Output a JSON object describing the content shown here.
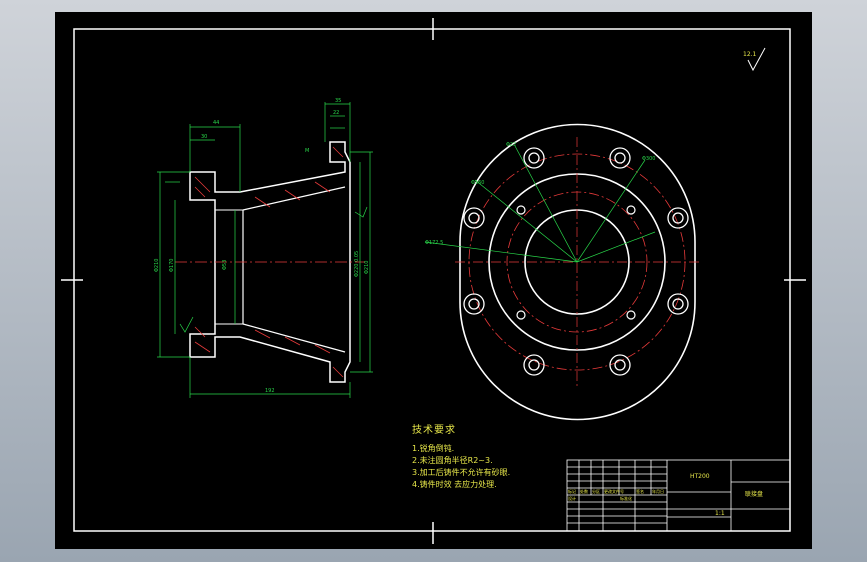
{
  "drawing": {
    "roughness_mark": "12.1",
    "section_labels": {
      "top_width": "44",
      "top_small": "30",
      "right_top": "35",
      "right_sub": "22",
      "flange_hole": "M",
      "bottom_length": "192",
      "left_dia_outer": "Φ210",
      "left_dia_inner": "Φ170",
      "bore": "Φ53",
      "right_dia": "Φ220 0.05",
      "right_dia2": "Φ210"
    },
    "plan_labels": {
      "hole_top_left": "Φ22",
      "hole_top_right": "Φ300",
      "pcd_left": "Φ160",
      "pcd_outer": "Φ172.5"
    }
  },
  "notes": {
    "title": "技术要求",
    "items": [
      "1.锐角倒钝.",
      "2.未注圆角半径R2~3.",
      "3.加工后铸件不允许有砂眼.",
      "4.铸件时效 去应力处理."
    ]
  },
  "title_block": {
    "material": "HT200",
    "part_name": "联接盘",
    "scale": "1:1",
    "row_labels": [
      "标记",
      "处数",
      "分区",
      "更改文件号",
      "签名",
      "年月日"
    ],
    "design_row": [
      "设计",
      "",
      "标准化"
    ]
  }
}
